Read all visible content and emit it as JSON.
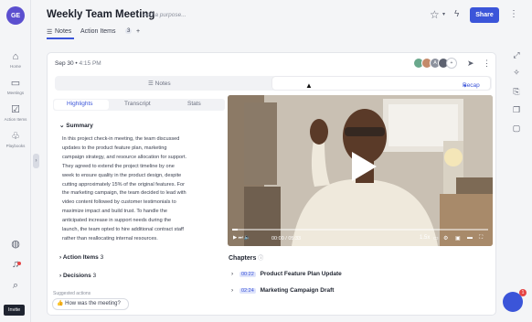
{
  "app": {
    "logo_text": "GE"
  },
  "sidebar": {
    "items": [
      {
        "label": "Home",
        "icon": "home-icon"
      },
      {
        "label": "Meetings",
        "icon": "calendar-icon"
      },
      {
        "label": "Action Items",
        "icon": "checkbox-icon"
      },
      {
        "label": "Playbooks",
        "icon": "playbook-icon"
      }
    ],
    "bottom_icons": [
      "chat-bubbles-icon",
      "bell-icon",
      "search-icon"
    ],
    "tooltip": "Invite"
  },
  "header": {
    "title": "Weekly Team Meeting",
    "purpose_placeholder": "Add a purpose...",
    "share_label": "Share",
    "tabs": [
      {
        "label": "Notes",
        "icon": "list-icon"
      },
      {
        "label": "Action Items",
        "count": "3"
      }
    ],
    "add_tab": "+"
  },
  "meeting": {
    "date": "Sep 30",
    "time": "4:15 PM",
    "avatar_letters": [
      "A"
    ],
    "view_toggle": {
      "notes": "Notes",
      "recap": "Recap"
    },
    "subtabs": [
      "Highlights",
      "Transcript",
      "Stats"
    ],
    "summary_title": "Summary",
    "summary_text": "In this project check-in meeting, the team discussed\nupdates to the product feature plan, marketing\ncampaign strategy, and resource allocation for support.\nThey agreed to extend the project timeline by one\nweek to ensure quality in the product design, despite\ncutting approximately 15% of the original features. For\nthe marketing campaign, the team decided to lead with\nvideo content followed by customer testimonials to\nmaximize impact and build trust. To handle the\nanticipated increase in support needs during the\nlaunch, the team opted to hire additional contract staff\nrather than reallocating internal resources.",
    "sections": [
      {
        "label": "Action Items",
        "count": "3"
      },
      {
        "label": "Decisions",
        "count": "3"
      }
    ],
    "suggested_label": "Suggested actions",
    "suggested_question": "How was the meeting?"
  },
  "video": {
    "time_display": "00:00 / 05:33",
    "speed": "1.5x",
    "progress": 0.02
  },
  "chapters": {
    "title": "Chapters",
    "items": [
      {
        "time": "00:22",
        "name": "Product Feature Plan Update"
      },
      {
        "time": "02:24",
        "name": "Marketing Campaign Draft"
      }
    ]
  },
  "right_rail": {
    "icons": [
      "expand-icon",
      "sparkle-icon",
      "share-box-icon",
      "layers-icon",
      "chat-icon"
    ]
  },
  "chat_widget": {
    "badge": "1"
  },
  "colors": {
    "accent": "#3b55d9",
    "badge": "#e64545",
    "logo": "#5b4fcf"
  }
}
